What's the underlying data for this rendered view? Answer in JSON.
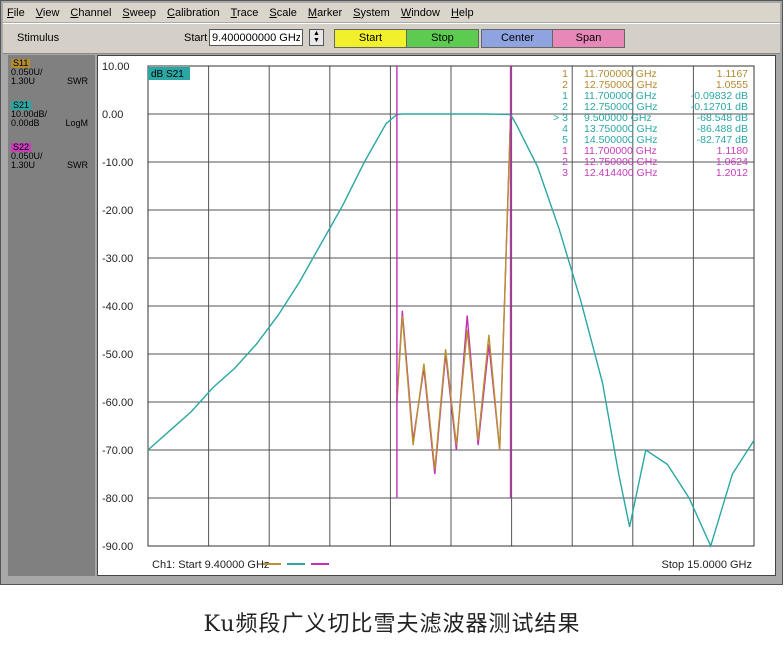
{
  "menu": [
    "File",
    "View",
    "Channel",
    "Sweep",
    "Calibration",
    "Trace",
    "Scale",
    "Marker",
    "System",
    "Window",
    "Help"
  ],
  "toolbar": {
    "stimulus_label": "Stimulus",
    "start_label": "Start",
    "start_value": "9.400000000 GHz",
    "btn_start": "Start",
    "btn_stop": "Stop",
    "btn_center": "Center",
    "btn_span": "Span"
  },
  "traces": [
    {
      "name": "S11",
      "line1": "0.050U/",
      "line2": "1.30U",
      "fmt": "SWR",
      "color": "#b38a2e"
    },
    {
      "name": "S21",
      "line1": "10.00dB/",
      "line2": "0.00dB",
      "fmt": "LogM",
      "color": "#2aa7a4"
    },
    {
      "name": "S22",
      "line1": "0.050U/",
      "line2": "1.30U",
      "fmt": "SWR",
      "color": "#c83cba"
    }
  ],
  "colors": {
    "s11": "#b8922e",
    "s21": "#2aa7a4",
    "s22": "#c42fb4"
  },
  "chart": {
    "trace_tag": "dB S21",
    "footer_left": "Ch1: Start 9.40000 GHz",
    "footer_right": "Stop 15.0000 GHz"
  },
  "chart_data": {
    "type": "line",
    "xlim": [
      9.4,
      15.0
    ],
    "ylim": [
      -90,
      10
    ],
    "y_ticks": [
      "10.00",
      "0.00",
      "-10.00",
      "-20.00",
      "-30.00",
      "-40.00",
      "-50.00",
      "-60.00",
      "-70.00",
      "-80.00",
      "-90.00"
    ],
    "grid": true,
    "series": [
      {
        "name": "S21",
        "x": [
          9.4,
          9.6,
          9.8,
          10.0,
          10.2,
          10.4,
          10.6,
          10.8,
          11.0,
          11.2,
          11.4,
          11.6,
          11.7,
          11.75,
          12.0,
          12.5,
          12.75,
          12.8,
          13.0,
          13.2,
          13.4,
          13.6,
          13.75,
          13.85,
          14.0,
          14.2,
          14.4,
          14.6,
          14.8,
          15.0
        ],
        "y": [
          -70,
          -66,
          -62,
          -57,
          -53,
          -48,
          -42,
          -35,
          -27,
          -19,
          -10,
          -2,
          -0.1,
          0,
          0,
          0,
          -0.1,
          -2,
          -11,
          -24,
          -39,
          -56,
          -75,
          -86,
          -70,
          -73,
          -80,
          -90,
          -75,
          -68
        ]
      },
      {
        "name": "S22",
        "x": [
          11.7,
          11.75,
          11.85,
          11.95,
          12.05,
          12.15,
          12.25,
          12.35,
          12.45,
          12.55,
          12.65,
          12.75
        ],
        "y": [
          -60,
          -41,
          -68,
          -53,
          -75,
          -50,
          -70,
          -42,
          -69,
          -48,
          -70,
          -1
        ]
      },
      {
        "name": "S11",
        "x": [
          11.7,
          11.75,
          11.85,
          11.95,
          12.05,
          12.15,
          12.25,
          12.35,
          12.45,
          12.55,
          12.65,
          12.75
        ],
        "y": [
          -60,
          -42,
          -69,
          -52,
          -74,
          -49,
          -69,
          -45,
          -68,
          -46,
          -70,
          -1
        ]
      }
    ],
    "markers": [
      {
        "n": "1",
        "freq": "11.700000 GHz",
        "val": "1.1167",
        "color": "#b38a2e"
      },
      {
        "n": "2",
        "freq": "12.750000 GHz",
        "val": "1.0555",
        "color": "#b38a2e"
      },
      {
        "n": "1",
        "freq": "11.700000 GHz",
        "val": "-0.09832 dB",
        "color": "#2aa7a4"
      },
      {
        "n": "2",
        "freq": "12.750000 GHz",
        "val": "-0.12701 dB",
        "color": "#2aa7a4"
      },
      {
        "n": "> 3",
        "freq": "9.500000 GHz",
        "val": "-68.548 dB",
        "color": "#2aa7a4"
      },
      {
        "n": "4",
        "freq": "13.750000 GHz",
        "val": "-86.488 dB",
        "color": "#2aa7a4"
      },
      {
        "n": "5",
        "freq": "14.500000 GHz",
        "val": "-82.747 dB",
        "color": "#2aa7a4"
      },
      {
        "n": "1",
        "freq": "11.700000 GHz",
        "val": "1.1180",
        "color": "#c83cba"
      },
      {
        "n": "2",
        "freq": "12.750000 GHz",
        "val": "1.0624",
        "color": "#c83cba"
      },
      {
        "n": "3",
        "freq": "12.414400 GHz",
        "val": "1.2012",
        "color": "#c83cba"
      }
    ]
  },
  "caption": "Ku频段广义切比雪夫滤波器测试结果"
}
